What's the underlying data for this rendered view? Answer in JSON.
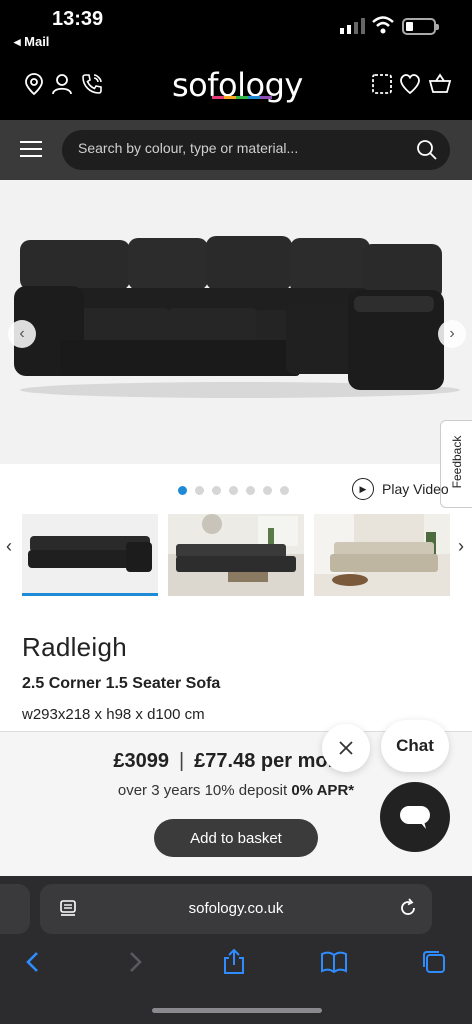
{
  "status_bar": {
    "time": "13:39",
    "back_app": "◂ Mail"
  },
  "header": {
    "logo": "sofology",
    "logo_colors": [
      "#e63b7a",
      "#f7a823",
      "#32b44a",
      "#1f8ad6",
      "#8b4fb5"
    ]
  },
  "search": {
    "placeholder": "Search by colour, type or material..."
  },
  "gallery": {
    "dot_count": 7,
    "active_dot": 0,
    "play_video_label": "Play Video"
  },
  "feedback_label": "Feedback",
  "product": {
    "name": "Radleigh",
    "subtitle": "2.5 Corner 1.5 Seater Sofa",
    "dimensions": "w293x218 x h98 x d100 cm"
  },
  "pricing": {
    "price": "£3099",
    "separator": "|",
    "monthly": "£77.48 per month",
    "finance_prefix": "over 3 years 10% deposit ",
    "finance_apr": "0% APR*",
    "add_to_basket": "Add to basket"
  },
  "chat": {
    "label": "Chat"
  },
  "safari": {
    "url": "sofology.co.uk"
  },
  "colors": {
    "accent": "#1f8ad6",
    "header_bg": "#000000",
    "search_band": "#3a3a3a"
  }
}
